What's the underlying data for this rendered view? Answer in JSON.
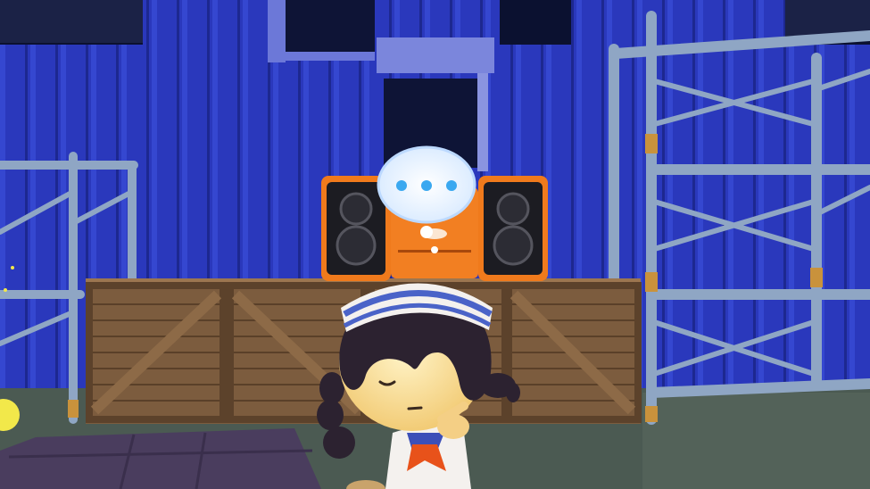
{
  "scene": {
    "colors": {
      "sky": "#0b1130",
      "wall": "#2836b8",
      "ground": "#4b5a52",
      "walkway": "#4a3d5e",
      "crate": "#7a5a3c",
      "scaffold": "#8fa6c4",
      "stereo_orange": "#f07a1c",
      "bubble_dots": "#3aa8f0",
      "scarf": "#e8521a"
    },
    "thought_bubble": {
      "dot_count": 3
    }
  }
}
